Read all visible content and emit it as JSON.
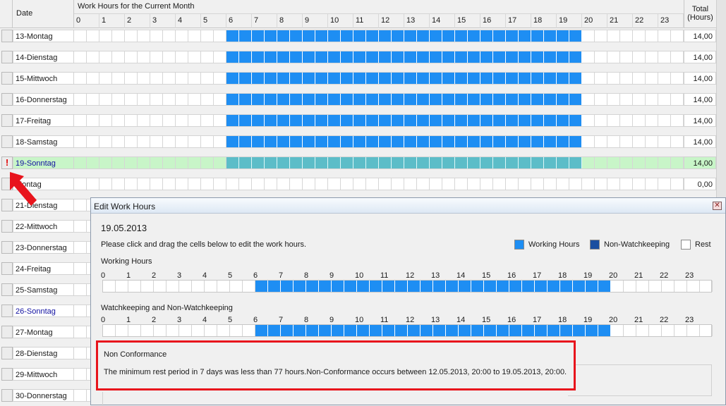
{
  "grid": {
    "header": {
      "date_label": "Date",
      "title": "Work Hours for the Current Month",
      "total_label_line1": "Total",
      "total_label_line2": "(Hours)"
    },
    "hours": [
      "0",
      "1",
      "2",
      "3",
      "4",
      "5",
      "6",
      "7",
      "8",
      "9",
      "10",
      "11",
      "12",
      "13",
      "14",
      "15",
      "16",
      "17",
      "18",
      "19",
      "20",
      "21",
      "22",
      "23"
    ],
    "rows": [
      {
        "date": "13-Montag",
        "total": "14,00",
        "sunday": false,
        "highlight": false,
        "flag": "",
        "work_start": 6,
        "work_end": 20
      },
      {
        "date": "14-Dienstag",
        "total": "14,00",
        "sunday": false,
        "highlight": false,
        "flag": "",
        "work_start": 6,
        "work_end": 20
      },
      {
        "date": "15-Mittwoch",
        "total": "14,00",
        "sunday": false,
        "highlight": false,
        "flag": "",
        "work_start": 6,
        "work_end": 20
      },
      {
        "date": "16-Donnerstag",
        "total": "14,00",
        "sunday": false,
        "highlight": false,
        "flag": "",
        "work_start": 6,
        "work_end": 20
      },
      {
        "date": "17-Freitag",
        "total": "14,00",
        "sunday": false,
        "highlight": false,
        "flag": "",
        "work_start": 6,
        "work_end": 20
      },
      {
        "date": "18-Samstag",
        "total": "14,00",
        "sunday": false,
        "highlight": false,
        "flag": "",
        "work_start": 6,
        "work_end": 20
      },
      {
        "date": "19-Sonntag",
        "total": "14,00",
        "sunday": true,
        "highlight": true,
        "flag": "!",
        "work_start": 6,
        "work_end": 20
      },
      {
        "date": "Montag",
        "total": "0,00",
        "sunday": false,
        "highlight": false,
        "flag": "",
        "work_start": 0,
        "work_end": 0
      },
      {
        "date": "21-Dienstag",
        "total": "",
        "sunday": false,
        "highlight": false,
        "flag": "",
        "work_start": 0,
        "work_end": 0
      },
      {
        "date": "22-Mittwoch",
        "total": "",
        "sunday": false,
        "highlight": false,
        "flag": "",
        "work_start": 0,
        "work_end": 0
      },
      {
        "date": "23-Donnerstag",
        "total": "",
        "sunday": false,
        "highlight": false,
        "flag": "",
        "work_start": 0,
        "work_end": 0
      },
      {
        "date": "24-Freitag",
        "total": "",
        "sunday": false,
        "highlight": false,
        "flag": "",
        "work_start": 0,
        "work_end": 0
      },
      {
        "date": "25-Samstag",
        "total": "",
        "sunday": false,
        "highlight": false,
        "flag": "",
        "work_start": 0,
        "work_end": 0
      },
      {
        "date": "26-Sonntag",
        "total": "",
        "sunday": true,
        "highlight": false,
        "flag": "",
        "work_start": 0,
        "work_end": 0
      },
      {
        "date": "27-Montag",
        "total": "",
        "sunday": false,
        "highlight": false,
        "flag": "",
        "work_start": 0,
        "work_end": 0
      },
      {
        "date": "28-Dienstag",
        "total": "",
        "sunday": false,
        "highlight": false,
        "flag": "",
        "work_start": 0,
        "work_end": 0
      },
      {
        "date": "29-Mittwoch",
        "total": "",
        "sunday": false,
        "highlight": false,
        "flag": "",
        "work_start": 0,
        "work_end": 0
      },
      {
        "date": "30-Donnerstag",
        "total": "",
        "sunday": false,
        "highlight": false,
        "flag": "",
        "work_start": 0,
        "work_end": 0
      }
    ]
  },
  "dialog": {
    "title": "Edit Work Hours",
    "close_icon": "close-icon",
    "date": "19.05.2013",
    "instruction": "Please click and drag the cells below to edit the work hours.",
    "legend": [
      {
        "label": "Working Hours",
        "color": "#1e8ef3"
      },
      {
        "label": "Non-Watchkeeping",
        "color": "#1a4fa0"
      },
      {
        "label": "Rest",
        "color": "#ffffff"
      }
    ],
    "working_hours_label": "Working Hours",
    "watchkeeping_label": "Watchkeeping and Non-Watchkeeping",
    "working_start": 6,
    "working_end": 20,
    "watch_start": 6,
    "watch_end": 20,
    "non_conformance": {
      "title": "Non Conformance",
      "text": "The minimum rest period in 7 days was less than 77 hours.Non-Conformance occurs between 12.05.2013, 20:00 to 19.05.2013, 20:00."
    }
  },
  "colors": {
    "work": "#1e8ef3",
    "highlight_row": "#c8f5c8",
    "alert": "#e8141c"
  }
}
